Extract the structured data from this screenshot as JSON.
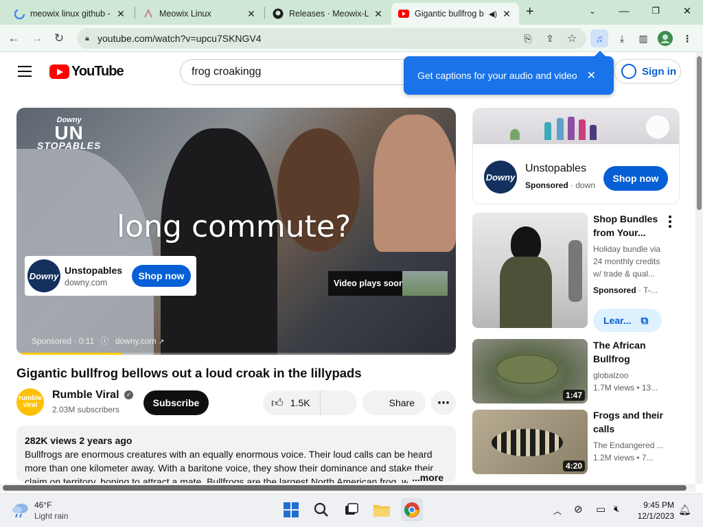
{
  "browser": {
    "tabs": [
      {
        "title": "meowix linux github -",
        "icon": "google-icon"
      },
      {
        "title": "Meowix Linux",
        "icon": "page-icon"
      },
      {
        "title": "Releases · Meowix-Lin",
        "icon": "github-icon"
      },
      {
        "title": "Gigantic bullfrog b",
        "icon": "youtube-icon",
        "active": true
      }
    ],
    "url": "youtube.com/watch?v=upcu7SKNGV4"
  },
  "youtube": {
    "logo_text": "YouTube",
    "search_value": "frog croakingg",
    "sign_in": "Sign in",
    "tooltip": "Get captions for your audio and video"
  },
  "player": {
    "brand_top": "Downy",
    "brand_mid": "UN",
    "brand_bottom": "STOPABLES",
    "headline": "long commute?",
    "ad_name": "Unstopables",
    "ad_domain": "downy.com",
    "ad_logo": "Downy",
    "shop_now": "Shop now",
    "plays_soon": "Video plays soon",
    "sponsored_line": "Sponsored · 0:11",
    "domain_line": "downy.com",
    "progress": 0.24
  },
  "video": {
    "title": "Gigantic bullfrog bellows out a loud croak in the lillypads",
    "channel": "Rumble Viral",
    "channel_avatar": "rumble viral",
    "subscribers": "2.03M subscribers",
    "subscribe": "Subscribe",
    "likes": "1.5K",
    "share": "Share",
    "views_age": "282K views  2 years ago",
    "description": "Bullfrogs are enormous creatures with an equally enormous voice. Their loud calls can be heard more than one kilometer away. With a baritone voice, they show their dominance and stake their claim on territory, hoping to attract a mate. Bullfrogs are the largest North American frog, w",
    "more": "...more"
  },
  "sidebar": {
    "ad": {
      "name": "Unstopables",
      "sponsored": "Sponsored",
      "source": "· down",
      "logo": "Downy",
      "shop_now": "Shop now"
    },
    "promo": {
      "title": "Shop Bundles from Your...",
      "line1": "Holiday bundle via",
      "line2": "24 monthly credits",
      "line3": "w/ trade & qual...",
      "sponsored": "Sponsored",
      "source": "· T-...",
      "learn": "Lear..."
    },
    "recs": [
      {
        "title": "The African Bullfrog",
        "channel": "globalzoo",
        "meta": "1.7M views  • 13...",
        "duration": "1:47"
      },
      {
        "title": "Frogs and their calls",
        "channel": "The Endangered ...",
        "meta": "1.2M views  • 7...",
        "duration": "4:20"
      }
    ]
  },
  "taskbar": {
    "temp": "46°F",
    "weather": "Light rain",
    "time": "9:45 PM",
    "date": "12/1/2023"
  }
}
